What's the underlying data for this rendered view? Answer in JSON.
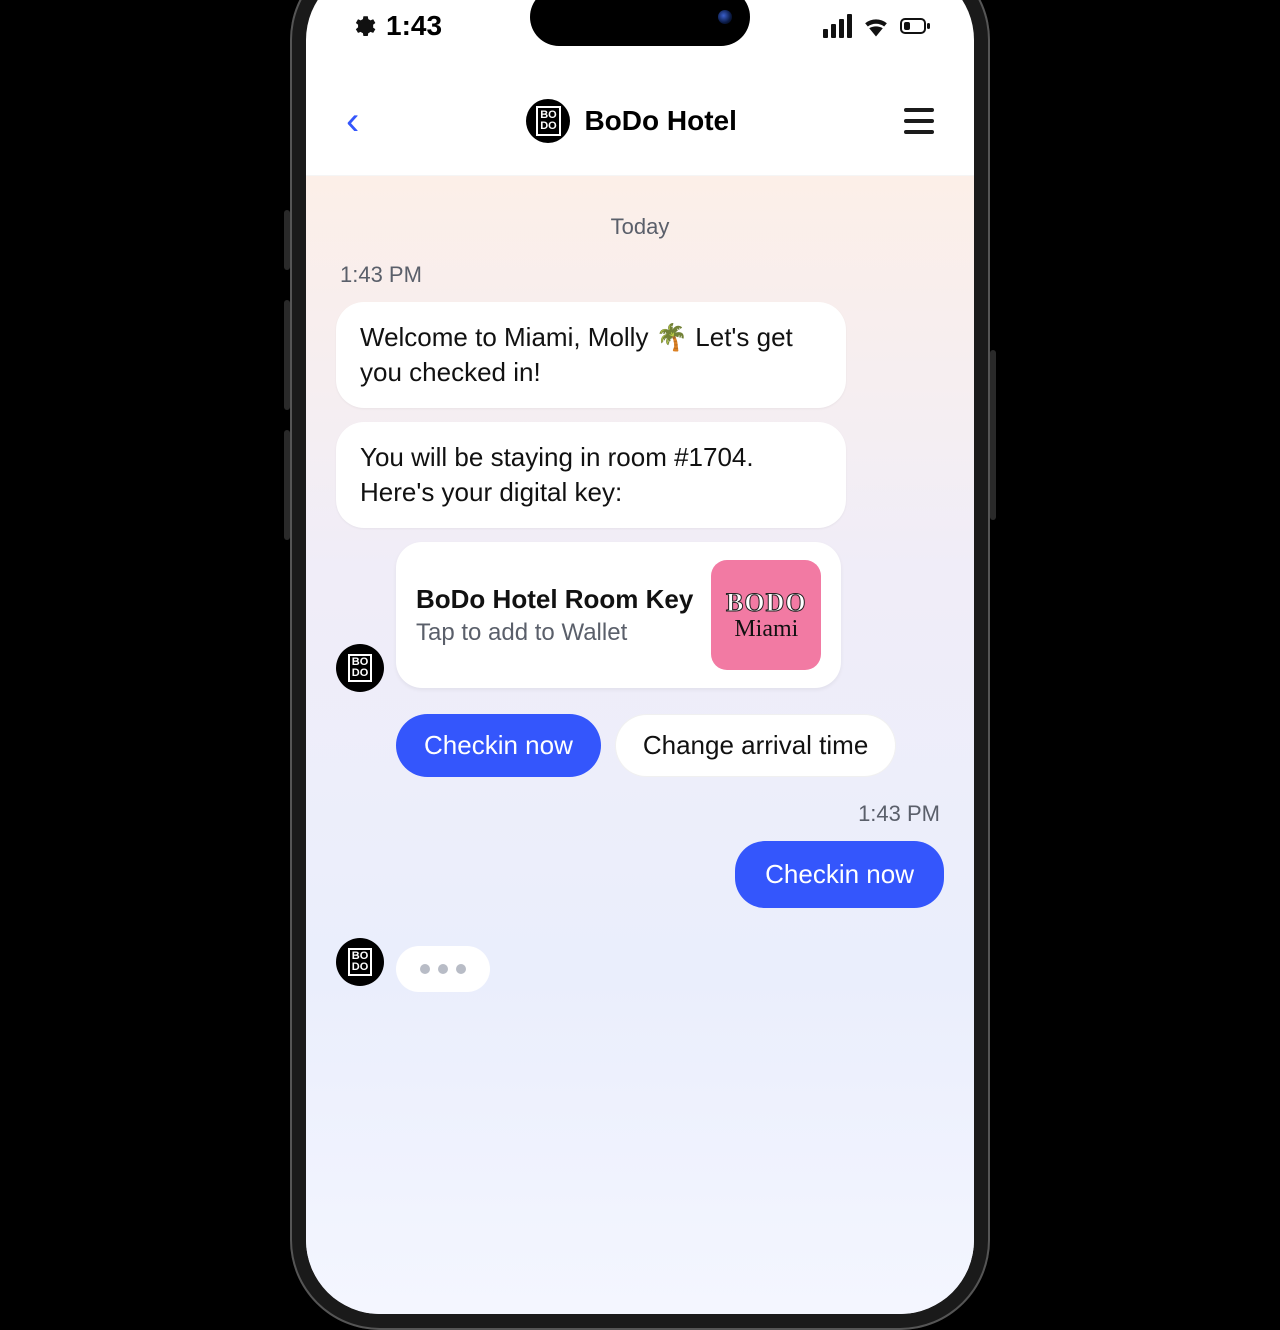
{
  "status": {
    "time": "1:43"
  },
  "nav": {
    "title": "BoDo Hotel",
    "logo_text": "BO\nDO"
  },
  "chat": {
    "day_label": "Today",
    "hotel_timestamp": "1:43 PM",
    "user_timestamp": "1:43 PM",
    "messages": {
      "welcome": "Welcome to Miami, Molly 🌴 Let's get you checked in!",
      "room": "You will be staying in room #1704. Here's your digital key:"
    },
    "card": {
      "title": "BoDo Hotel Room Key",
      "subtitle": "Tap to add to Wallet",
      "badge_top": "BODO",
      "badge_bottom": "Miami"
    },
    "quick_replies": {
      "primary": "Checkin now",
      "secondary": "Change arrival time"
    },
    "user_message": "Checkin now"
  }
}
